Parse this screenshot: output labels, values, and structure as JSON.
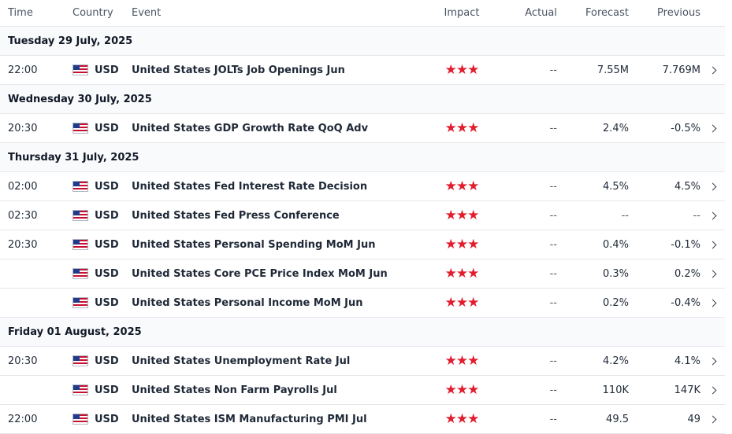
{
  "columns": {
    "time": "Time",
    "country": "Country",
    "event": "Event",
    "impact": "Impact",
    "actual": "Actual",
    "forecast": "Forecast",
    "previous": "Previous"
  },
  "dates": [
    "Tuesday 29 July, 2025",
    "Wednesday 30 July, 2025",
    "Thursday 31 July, 2025",
    "Friday 01 August, 2025"
  ],
  "rows": [
    {
      "time": "22:00",
      "currency": "USD",
      "event": "United States JOLTs Job Openings Jun",
      "actual": "--",
      "forecast": "7.55M",
      "previous": "7.769M"
    },
    {
      "time": "20:30",
      "currency": "USD",
      "event": "United States GDP Growth Rate QoQ Adv",
      "actual": "--",
      "forecast": "2.4%",
      "previous": "-0.5%"
    },
    {
      "time": "02:00",
      "currency": "USD",
      "event": "United States Fed Interest Rate Decision",
      "actual": "--",
      "forecast": "4.5%",
      "previous": "4.5%"
    },
    {
      "time": "02:30",
      "currency": "USD",
      "event": "United States Fed Press Conference",
      "actual": "--",
      "forecast": "--",
      "previous": "--"
    },
    {
      "time": "20:30",
      "currency": "USD",
      "event": "United States Personal Spending MoM Jun",
      "actual": "--",
      "forecast": "0.4%",
      "previous": "-0.1%"
    },
    {
      "time": "",
      "currency": "USD",
      "event": "United States Core PCE Price Index MoM Jun",
      "actual": "--",
      "forecast": "0.3%",
      "previous": "0.2%"
    },
    {
      "time": "",
      "currency": "USD",
      "event": "United States Personal Income MoM Jun",
      "actual": "--",
      "forecast": "0.2%",
      "previous": "-0.4%"
    },
    {
      "time": "20:30",
      "currency": "USD",
      "event": "United States Unemployment Rate Jul",
      "actual": "--",
      "forecast": "4.2%",
      "previous": "4.1%"
    },
    {
      "time": "",
      "currency": "USD",
      "event": "United States Non Farm Payrolls Jul",
      "actual": "--",
      "forecast": "110K",
      "previous": "147K"
    },
    {
      "time": "22:00",
      "currency": "USD",
      "event": "United States ISM Manufacturing PMI Jul",
      "actual": "--",
      "forecast": "49.5",
      "previous": "49"
    }
  ],
  "impact_stars": "★★★",
  "icons": {
    "flag": "us-flag-icon",
    "arrow": "chevron-right-icon",
    "impact": "star-icon"
  },
  "colors": {
    "impact_star": "#e11d2e"
  }
}
